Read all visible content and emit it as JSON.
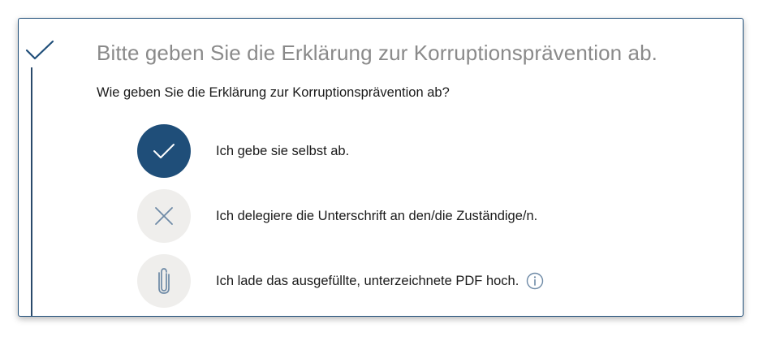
{
  "step": {
    "title": "Bitte geben Sie die Erklärung zur Korruptionsprävention ab.",
    "question": "Wie geben Sie die Erklärung zur Korruptionsprävention ab?",
    "status_icon": "check-icon"
  },
  "options": [
    {
      "label": "Ich gebe sie selbst ab.",
      "icon": "check-icon",
      "selected": true
    },
    {
      "label": "Ich delegiere die Unterschrift an den/die Zuständige/n.",
      "icon": "close-icon",
      "selected": false
    },
    {
      "label": "Ich lade das ausgefüllte, unterzeichnete PDF hoch.",
      "icon": "paperclip-icon",
      "selected": false,
      "has_info": true
    }
  ],
  "colors": {
    "accent": "#1f4e79",
    "option_bg": "#efeeec",
    "title_gray": "#8a8a8a",
    "icon_gray": "#6e8aa6"
  }
}
